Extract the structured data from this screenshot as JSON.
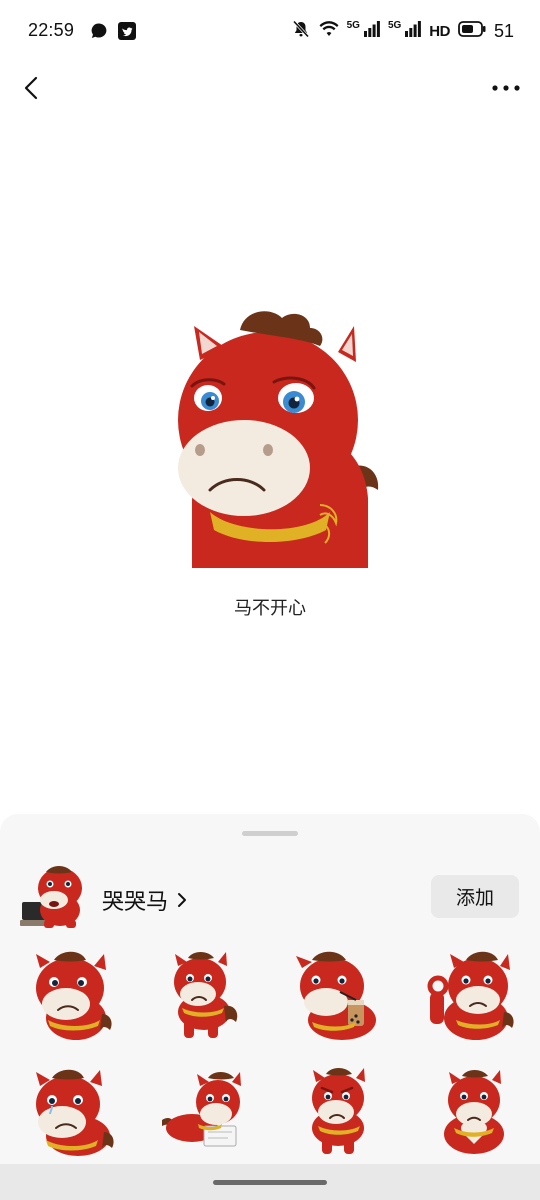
{
  "status_bar": {
    "time": "22:59",
    "net_label_1": "5G",
    "net_label_2": "5G",
    "hd_label": "HD",
    "battery": "51",
    "icons": [
      "chat-bubble-icon",
      "twitter-icon",
      "mute-icon",
      "wifi-icon",
      "signal-icon",
      "signal-icon",
      "battery-icon"
    ]
  },
  "header": {
    "back_icon": "back-arrow-icon",
    "more_icon": "more-dots-icon"
  },
  "preview": {
    "caption": "马不开心",
    "sticker": "sad-red-horse"
  },
  "pack": {
    "title": "哭哭马",
    "chevron": "›",
    "add_label": "添加"
  },
  "stickers": [
    {
      "name": "horse-sad-shrug"
    },
    {
      "name": "horse-sad-standing"
    },
    {
      "name": "horse-drinking-tea"
    },
    {
      "name": "horse-ok-gesture"
    },
    {
      "name": "horse-tearful"
    },
    {
      "name": "horse-lying-writing"
    },
    {
      "name": "horse-angry"
    },
    {
      "name": "horse-heart-hands"
    }
  ],
  "colors": {
    "horse_red": "#c8281e",
    "horse_dark_red": "#9a1a12",
    "mane_brown": "#6b3418",
    "muzzle_cream": "#f3ebe0",
    "collar_yellow": "#e0b025",
    "sheet_bg": "#f7f7f7",
    "add_button_bg": "#e9e9e9"
  }
}
